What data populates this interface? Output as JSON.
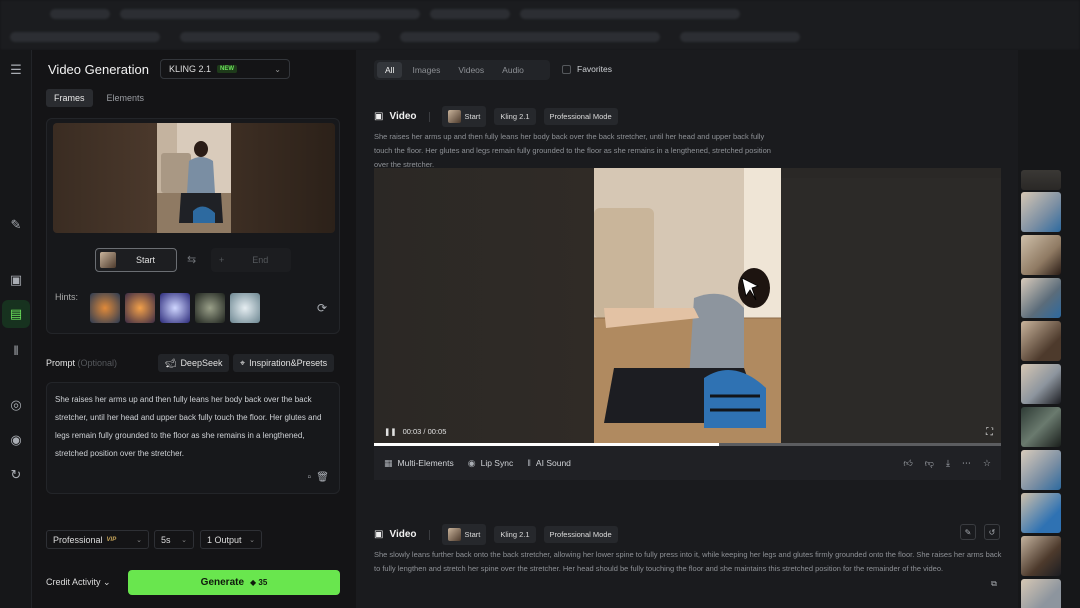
{
  "header": {
    "title": "Video Generation",
    "model": "KLING 2.1",
    "model_badge": "NEW"
  },
  "subtabs": [
    "Frames",
    "Elements"
  ],
  "frames": {
    "start_label": "Start",
    "end_label": "End",
    "hints_label": "Hints:"
  },
  "prompt": {
    "label": "Prompt",
    "optional": "(Optional)",
    "deepseek": "DeepSeek",
    "inspiration": "Inspiration&Presets",
    "text": "She raises her arms up and then fully leans her body back over the back stretcher, until her head and upper back fully touch the floor. Her glutes and legs remain fully grounded to the floor as she remains in a lengthened, stretched position over the stretcher."
  },
  "settings": {
    "mode": "Professional",
    "mode_badge": "VIP",
    "duration": "5s",
    "outputs": "1 Output"
  },
  "footer": {
    "credit": "Credit Activity",
    "generate": "Generate",
    "cost": "35"
  },
  "filters": {
    "tabs": [
      "All",
      "Images",
      "Videos",
      "Audio"
    ],
    "favorites": "Favorites"
  },
  "cards": [
    {
      "type": "Video",
      "chips": [
        "Start",
        "Kling 2.1",
        "Professional Mode"
      ],
      "desc": "She raises her arms up and then fully leans her body back over the back stretcher, until her head and upper back fully touch the floor. Her glutes and legs remain fully grounded to the floor as she remains in a lengthened, stretched position over the stretcher.",
      "time": "00:03 / 00:05",
      "progress": 0.55,
      "actions": [
        "Multi-Elements",
        "Lip Sync",
        "AI Sound"
      ]
    },
    {
      "type": "Video",
      "chips": [
        "Start",
        "Kling 2.1",
        "Professional Mode"
      ],
      "desc": "She slowly leans further back onto the back stretcher, allowing her lower spine to fully press into it, while keeping her legs and glutes firmly grounded onto the floor. She raises her arms back to fully lengthen and stretch her spine over the stretcher. Her head should be fully touching the floor and she maintains this stretched position for the remainder of the video."
    }
  ],
  "colors": {
    "accent": "#69e64e",
    "bg": "#141416"
  }
}
